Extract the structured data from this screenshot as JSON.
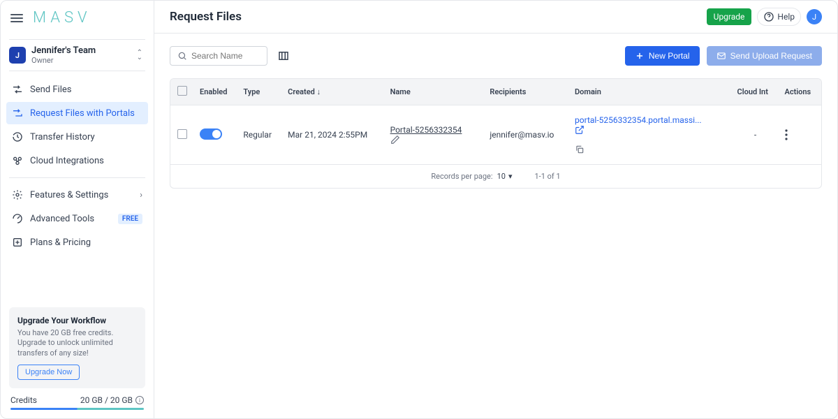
{
  "brand": "MASV",
  "team": {
    "avatar": "J",
    "name": "Jennifer's Team",
    "role": "Owner"
  },
  "sidebar": {
    "items": [
      {
        "label": "Send Files"
      },
      {
        "label": "Request Files with Portals"
      },
      {
        "label": "Transfer History"
      },
      {
        "label": "Cloud Integrations"
      },
      {
        "label": "Features & Settings"
      },
      {
        "label": "Advanced Tools",
        "badge": "FREE"
      },
      {
        "label": "Plans & Pricing"
      }
    ]
  },
  "upgrade_card": {
    "title": "Upgrade Your Workflow",
    "desc": "You have 20 GB free credits. Upgrade to unlock unlimited transfers of any size!",
    "button": "Upgrade Now"
  },
  "credits": {
    "label": "Credits",
    "value": "20 GB / 20 GB"
  },
  "header": {
    "title": "Request Files",
    "upgrade": "Upgrade",
    "help": "Help",
    "avatar": "J"
  },
  "toolbar": {
    "search_placeholder": "Search Name",
    "new_portal": "New Portal",
    "send_upload": "Send Upload Request"
  },
  "table": {
    "columns": [
      "Enabled",
      "Type",
      "Created",
      "Name",
      "Recipients",
      "Domain",
      "Cloud Int",
      "Actions"
    ],
    "rows": [
      {
        "enabled": true,
        "type": "Regular",
        "created": "Mar 21, 2024 2:55PM",
        "name": "Portal-5256332354",
        "recipients": "jennifer@masv.io",
        "domain": "portal-5256332354.portal.massi...",
        "cloud": "-"
      }
    ]
  },
  "pager": {
    "records_label": "Records per page:",
    "per_page": "10",
    "range": "1-1 of 1"
  }
}
